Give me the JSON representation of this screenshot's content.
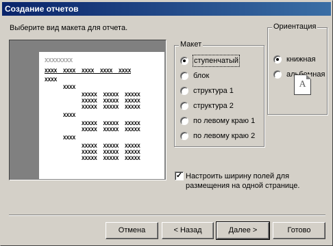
{
  "window": {
    "title": "Создание отчетов"
  },
  "prompt": "Выберите вид макета для отчета.",
  "preview": {
    "title_text": "XXXXXXXX",
    "header_text": "XXXX  XXXX  XXXX  XXXX  XXXX",
    "lines": [
      "XXXX",
      "      XXXX",
      "            XXXXX  XXXXX  XXXXX",
      "            XXXXX  XXXXX  XXXXX",
      "            XXXXX  XXXXX  XXXXX",
      "      XXXX",
      "            XXXXX  XXXXX  XXXXX",
      "            XXXXX  XXXXX  XXXXX",
      "      XXXX",
      "            XXXXX  XXXXX  XXXXX",
      "            XXXXX  XXXXX  XXXXX",
      "            XXXXX  XXXXX  XXXXX"
    ]
  },
  "layout_group": {
    "legend": "Макет",
    "options": [
      {
        "label": "ступенчатый",
        "selected": true
      },
      {
        "label": "блок",
        "selected": false
      },
      {
        "label": "структура 1",
        "selected": false
      },
      {
        "label": "структура 2",
        "selected": false
      },
      {
        "label": "по левому краю 1",
        "selected": false
      },
      {
        "label": "по левому краю 2",
        "selected": false
      }
    ]
  },
  "orientation_group": {
    "legend": "Ориентация",
    "options": [
      {
        "label": "книжная",
        "selected": true
      },
      {
        "label": "альбомная",
        "selected": false
      }
    ],
    "icon_letter": "A"
  },
  "fit_checkbox": {
    "label": "Настроить ширину полей для размещения на одной странице.",
    "checked": true
  },
  "buttons": {
    "cancel": "Отмена",
    "back": "< Назад",
    "next": "Далее >",
    "finish": "Готово"
  }
}
